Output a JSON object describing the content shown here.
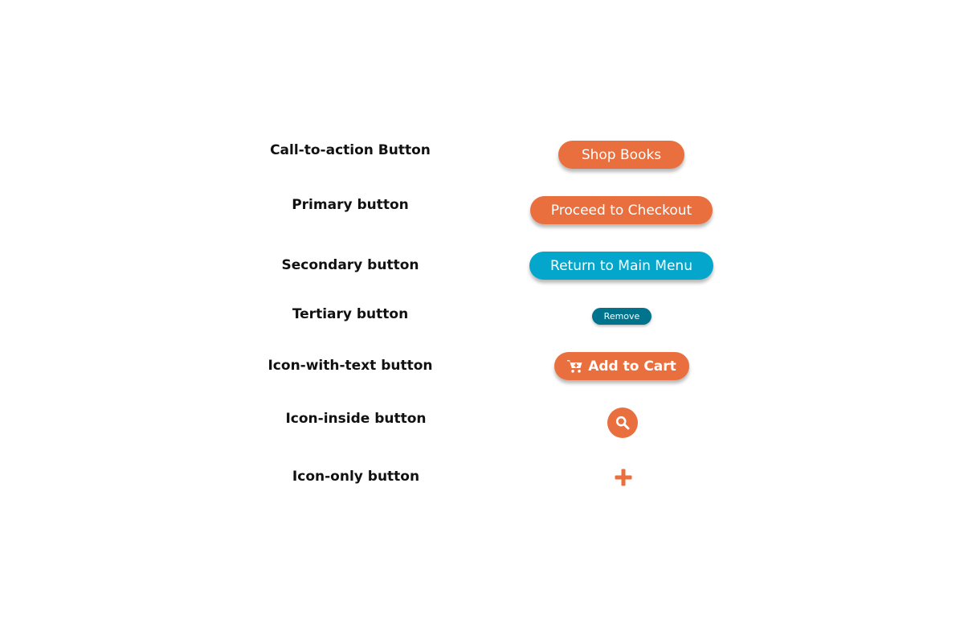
{
  "colors": {
    "orange": "#ea6f3e",
    "cyan": "#04a7cb",
    "teal": "#00738d",
    "text": "#111111"
  },
  "rows": [
    {
      "label": "Call-to-action Button",
      "button_text": "Shop Books"
    },
    {
      "label": "Primary button",
      "button_text": "Proceed to Checkout"
    },
    {
      "label": "Secondary button",
      "button_text": "Return to Main Menu"
    },
    {
      "label": "Tertiary button",
      "button_text": "Remove"
    },
    {
      "label": "Icon-with-text button",
      "button_text": "Add to Cart",
      "icon": "cart-add-icon"
    },
    {
      "label": "Icon-inside button",
      "icon": "search-icon"
    },
    {
      "label": "Icon-only button",
      "icon": "plus-icon"
    }
  ]
}
